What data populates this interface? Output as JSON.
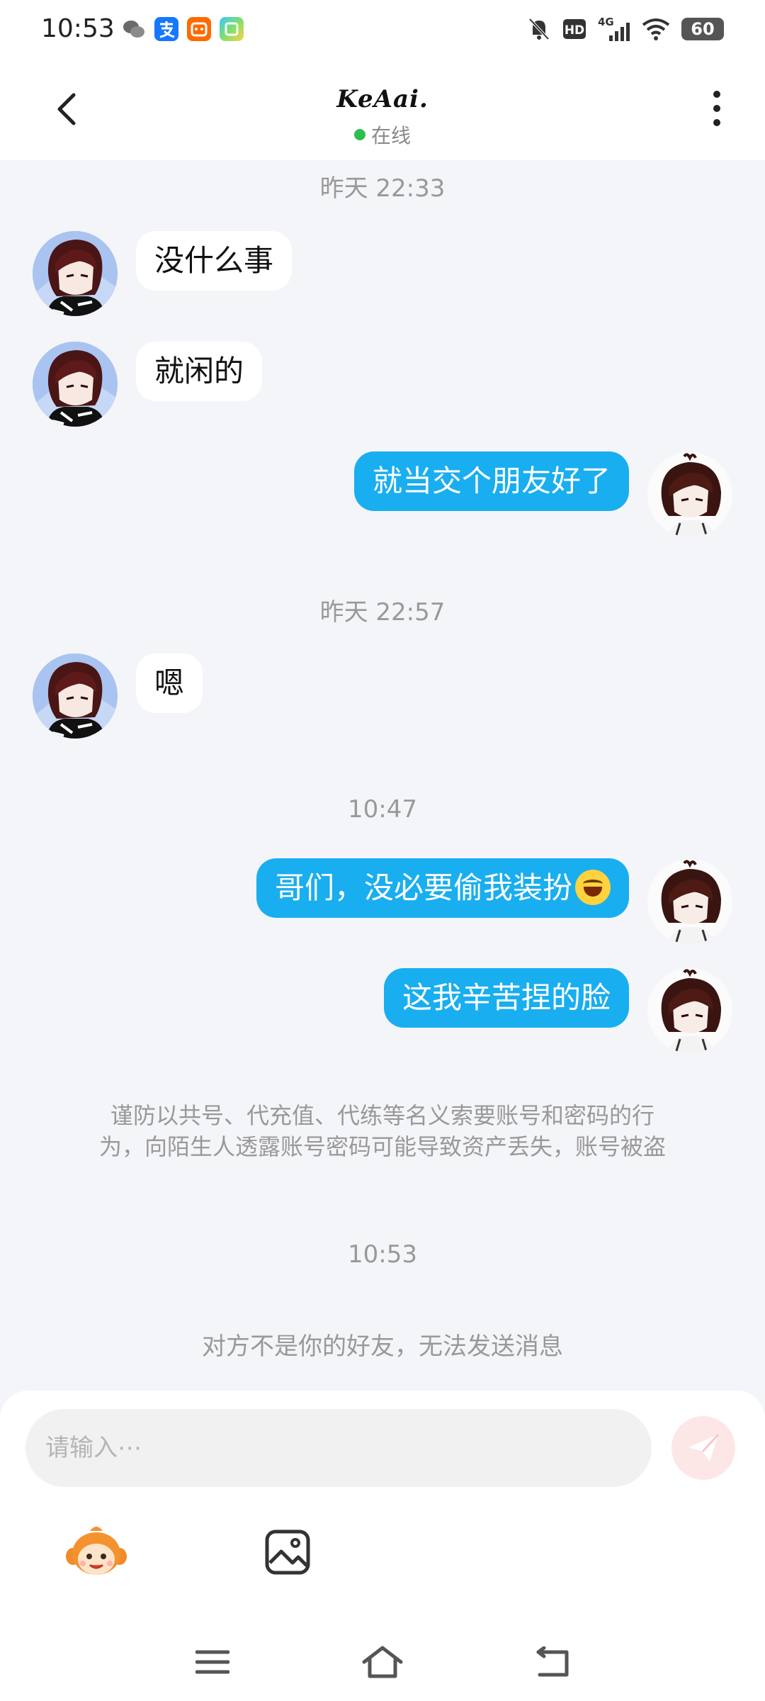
{
  "status_bar": {
    "time": "10:53",
    "app_icons": [
      "wechat-icon",
      "alipay-icon",
      "taobao-icon",
      "app-store-icon"
    ],
    "battery_level": "60"
  },
  "header": {
    "title": "KeAai.",
    "status": "在线",
    "online_color": "#2dbf4c"
  },
  "timestamps": [
    "昨天 22:33",
    "昨天 22:57",
    "10:47",
    "10:53"
  ],
  "messages": [
    {
      "side": "left",
      "text": "没什么事"
    },
    {
      "side": "left",
      "text": "就闲的"
    },
    {
      "side": "right",
      "text": "就当交个朋友好了"
    },
    {
      "side": "left",
      "text": "嗯"
    },
    {
      "side": "right",
      "text": "哥们，没必要偷我装扮",
      "emoji": "grinning-sweat-emoji"
    },
    {
      "side": "right",
      "text": "这我辛苦捏的脸"
    }
  ],
  "system": {
    "warning_line1": "谨防以共号、代充值、代练等名义索要账号和密码的行",
    "warning_line2": "为，向陌生人透露账号密码可能导致资产丢失，账号被盗",
    "not_friend": "对方不是你的好友，无法发送消息"
  },
  "input": {
    "placeholder": "请输入⋯",
    "value": ""
  },
  "colors": {
    "sent_bubble": "#19aeef",
    "received_bubble": "#ffffff",
    "background": "#f4f5f9"
  }
}
